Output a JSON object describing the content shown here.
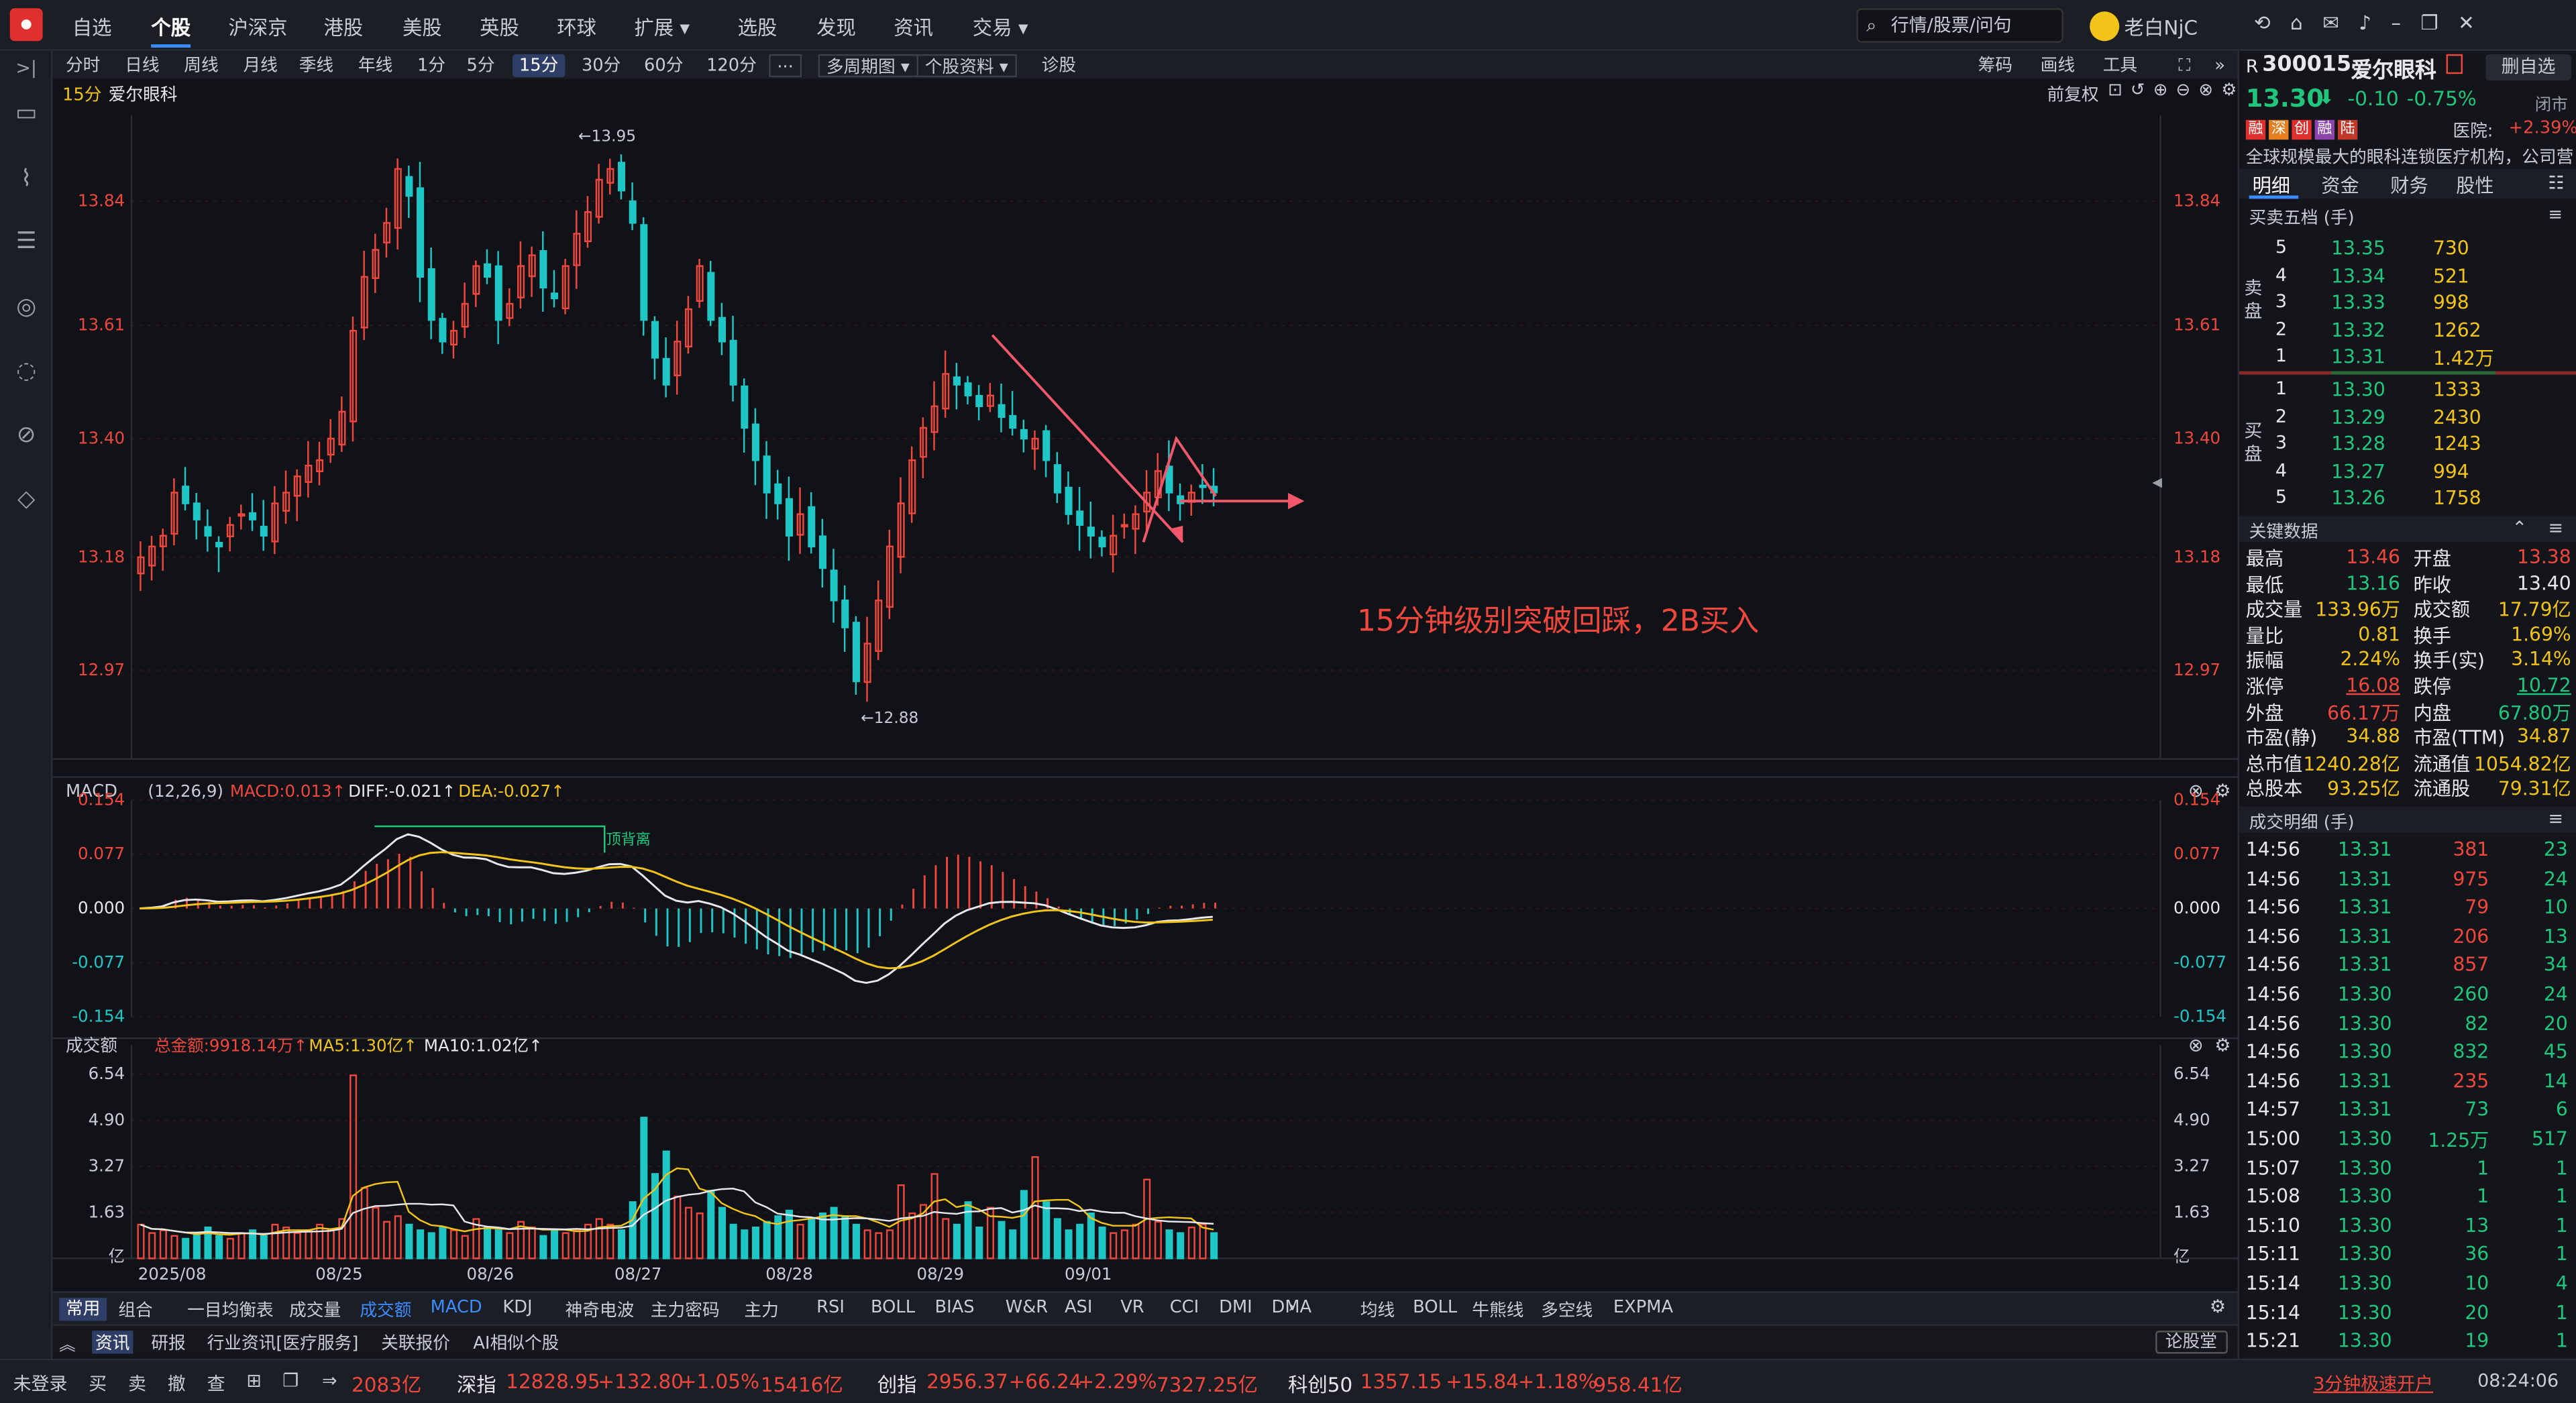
{
  "menu": {
    "items": [
      "自选",
      "个股",
      "沪深京",
      "港股",
      "美股",
      "英股",
      "环球",
      "扩展",
      "选股",
      "发现",
      "资讯",
      "交易"
    ],
    "search_placeholder": "行情/股票/问句",
    "user": "老白NjC"
  },
  "toolbar": {
    "items": [
      "分时",
      "日线",
      "周线",
      "月线",
      "季线",
      "年线",
      "1分",
      "5分",
      "15分",
      "30分",
      "60分",
      "120分",
      "···",
      "多周期图",
      "个股资料",
      "诊股"
    ],
    "right": [
      "筹码",
      "画线",
      "工具"
    ]
  },
  "chart": {
    "period": "15分",
    "name": "爱尔眼科",
    "restore": "前复权",
    "annotation": "15分钟级别突破回踩，2B买入",
    "high_label": "←13.95",
    "low_label": "←12.88",
    "x_labels": [
      "2025/08",
      "08/25",
      "08/26",
      "08/27",
      "08/28",
      "08/29",
      "09/01"
    ]
  },
  "chart_data": [
    {
      "type": "candlestick",
      "title": "15分",
      "y_ticks": [
        13.84,
        13.61,
        13.4,
        13.18,
        12.97
      ],
      "high": 13.95,
      "low": 12.88,
      "close": [
        13.18,
        13.2,
        13.22,
        13.3,
        13.28,
        13.25,
        13.22,
        13.2,
        13.24,
        13.26,
        13.25,
        13.22,
        13.28,
        13.3,
        13.33,
        13.35,
        13.36,
        13.4,
        13.45,
        13.6,
        13.7,
        13.75,
        13.8,
        13.9,
        13.85,
        13.7,
        13.62,
        13.58,
        13.6,
        13.65,
        13.72,
        13.7,
        13.62,
        13.65,
        13.72,
        13.74,
        13.68,
        13.66,
        13.72,
        13.78,
        13.82,
        13.88,
        13.9,
        13.86,
        13.8,
        13.62,
        13.55,
        13.5,
        13.58,
        13.64,
        13.72,
        13.62,
        13.58,
        13.5,
        13.42,
        13.36,
        13.3,
        13.28,
        13.22,
        13.26,
        13.2,
        13.16,
        13.1,
        13.05,
        12.95,
        13.02,
        13.1,
        13.2,
        13.28,
        13.36,
        13.42,
        13.46,
        13.52,
        13.5,
        13.48,
        13.46,
        13.48,
        13.44,
        13.42,
        13.4,
        13.4,
        13.36,
        13.3,
        13.26,
        13.24,
        13.22,
        13.2,
        13.22,
        13.24,
        13.26,
        13.3,
        13.34,
        13.3,
        13.28,
        13.3,
        13.31,
        13.3
      ],
      "volume": [
        1.2,
        0.9,
        1.0,
        0.8,
        0.7,
        0.9,
        1.1,
        0.8,
        0.7,
        0.9,
        1.0,
        0.8,
        1.2,
        1.1,
        0.9,
        1.0,
        1.2,
        1.0,
        1.4,
        6.5,
        2.5,
        1.8,
        1.3,
        1.5,
        1.2,
        1.0,
        0.9,
        1.1,
        1.0,
        0.8,
        1.4,
        1.1,
        1.0,
        0.9,
        1.3,
        1.1,
        0.8,
        1.0,
        0.9,
        1.0,
        1.2,
        1.4,
        1.2,
        1.0,
        2.0,
        5.0,
        3.0,
        3.8,
        2.2,
        1.8,
        1.6,
        2.4,
        1.8,
        1.2,
        1.0,
        1.1,
        1.3,
        1.5,
        1.7,
        1.2,
        1.4,
        1.6,
        1.8,
        1.5,
        1.2,
        1.0,
        0.9,
        1.0,
        2.6,
        1.6,
        1.9,
        3.0,
        1.4,
        1.2,
        2.0,
        1.1,
        1.8,
        1.3,
        1.0,
        2.4,
        3.6,
        2.0,
        1.4,
        1.0,
        1.2,
        1.6,
        1.1,
        0.9,
        1.0,
        1.2,
        2.8,
        1.3,
        1.0,
        0.9,
        1.1,
        1.2,
        0.9
      ]
    },
    {
      "type": "line",
      "title": "MACD",
      "params": "(12,26,9)",
      "MACD": "0.013",
      "DIFF": "-0.021",
      "DEA": "-0.027",
      "y_ticks": [
        0.154,
        0.077,
        0.0,
        -0.077,
        -0.154
      ],
      "annotation": "顶背离"
    },
    {
      "type": "bar",
      "title": "成交额",
      "total": "总金额:9918.14万",
      "MA5": "1.30亿",
      "MA10": "1.02亿",
      "y_ticks": [
        6.54,
        4.9,
        3.27,
        1.63
      ],
      "unit": "亿"
    }
  ],
  "macd_row": {
    "label": "MACD"
  },
  "vol_row": {
    "label": "成交额"
  },
  "stock": {
    "market": "R",
    "code": "300015",
    "name": "爱尔眼科",
    "add_label": "删自选",
    "price": "13.30",
    "change": "-0.10",
    "change_pct": "-0.75%",
    "status": "闭市",
    "tags": [
      "融",
      "深",
      "创",
      "融",
      "陆"
    ],
    "sector": "医院:",
    "sector_pct": "+2.39%",
    "desc": "全球规模最大的眼科连锁医疗机构，公司营...",
    "tabs": [
      "明细",
      "资金",
      "财务",
      "股性"
    ]
  },
  "order_book": {
    "title": "买卖五档 (手)",
    "sell_label": "卖盘",
    "buy_label": "买盘",
    "asks": [
      {
        "lvl": "5",
        "price": "13.35",
        "vol": "730"
      },
      {
        "lvl": "4",
        "price": "13.34",
        "vol": "521"
      },
      {
        "lvl": "3",
        "price": "13.33",
        "vol": "998"
      },
      {
        "lvl": "2",
        "price": "13.32",
        "vol": "1262"
      },
      {
        "lvl": "1",
        "price": "13.31",
        "vol": "1.42万"
      }
    ],
    "bids": [
      {
        "lvl": "1",
        "price": "13.30",
        "vol": "1333"
      },
      {
        "lvl": "2",
        "price": "13.29",
        "vol": "2430"
      },
      {
        "lvl": "3",
        "price": "13.28",
        "vol": "1243"
      },
      {
        "lvl": "4",
        "price": "13.27",
        "vol": "994"
      },
      {
        "lvl": "5",
        "price": "13.26",
        "vol": "1758"
      }
    ]
  },
  "key_data": {
    "title": "关键数据",
    "rows": [
      [
        "最高",
        "13.46",
        "开盘",
        "13.38"
      ],
      [
        "最低",
        "13.16",
        "昨收",
        "13.40"
      ],
      [
        "成交量",
        "133.96万",
        "成交额",
        "17.79亿"
      ],
      [
        "量比",
        "0.81",
        "换手",
        "1.69%"
      ],
      [
        "振幅",
        "2.24%",
        "换手(实)",
        "3.14%"
      ],
      [
        "涨停",
        "16.08",
        "跌停",
        "10.72"
      ],
      [
        "外盘",
        "66.17万",
        "内盘",
        "67.80万"
      ],
      [
        "市盈(静)",
        "34.88",
        "市盈(TTM)",
        "34.87"
      ],
      [
        "总市值",
        "1240.28亿",
        "流通值",
        "1054.82亿"
      ],
      [
        "总股本",
        "93.25亿",
        "流通股",
        "79.31亿"
      ]
    ]
  },
  "trades": {
    "title": "成交明细 (手)",
    "rows": [
      [
        "14:56",
        "13.31",
        "381",
        "23"
      ],
      [
        "14:56",
        "13.31",
        "975",
        "24"
      ],
      [
        "14:56",
        "13.31",
        "79",
        "10"
      ],
      [
        "14:56",
        "13.31",
        "206",
        "13"
      ],
      [
        "14:56",
        "13.31",
        "857",
        "34"
      ],
      [
        "14:56",
        "13.30",
        "260",
        "24"
      ],
      [
        "14:56",
        "13.30",
        "82",
        "20"
      ],
      [
        "14:56",
        "13.30",
        "832",
        "45"
      ],
      [
        "14:56",
        "13.31",
        "235",
        "14"
      ],
      [
        "14:57",
        "13.31",
        "73",
        "6"
      ],
      [
        "15:00",
        "13.30",
        "1.25万",
        "517"
      ],
      [
        "15:07",
        "13.30",
        "1",
        "1"
      ],
      [
        "15:08",
        "13.30",
        "1",
        "1"
      ],
      [
        "15:10",
        "13.30",
        "13",
        "1"
      ],
      [
        "15:11",
        "13.30",
        "36",
        "1"
      ],
      [
        "15:14",
        "13.30",
        "10",
        "4"
      ],
      [
        "15:14",
        "13.30",
        "20",
        "1"
      ],
      [
        "15:21",
        "13.30",
        "19",
        "1"
      ]
    ]
  },
  "indicator_tabs": {
    "left": [
      "常用",
      "组合"
    ],
    "items": [
      "一目均衡表",
      "成交量",
      "成交额",
      "MACD",
      "KDJ",
      "神奇电波",
      "主力密码",
      "主力",
      "RSI",
      "BOLL",
      "BIAS",
      "W&R",
      "ASI",
      "VR",
      "CCI",
      "DMI",
      "DMA"
    ],
    "right": [
      "均线",
      "BOLL",
      "牛熊线",
      "多空线",
      "EXPMA"
    ]
  },
  "news_tabs": {
    "items": [
      "资讯",
      "研报",
      "行业资讯[医疗服务]",
      "关联报价",
      "AI相似个股"
    ],
    "right": "论股堂"
  },
  "status": {
    "login": "未登录",
    "actions": [
      "买",
      "卖",
      "撤",
      "查"
    ],
    "sh_amount": "2083亿",
    "sz_name": "深指",
    "sz_val": "12828.95",
    "sz_chg": "+132.80",
    "sz_pct": "+1.05%",
    "sz_amt": "15416亿",
    "cy_name": "创指",
    "cy_val": "2956.37",
    "cy_chg": "+66.24",
    "cy_pct": "+2.29%",
    "cy_amt": "7327.25亿",
    "kc_name": "科创50",
    "kc_val": "1357.15",
    "kc_chg": "+15.84",
    "kc_pct": "+1.18%",
    "kc_amt": "958.41亿",
    "promo": "3分钟极速开户",
    "time": "08:24:06"
  }
}
